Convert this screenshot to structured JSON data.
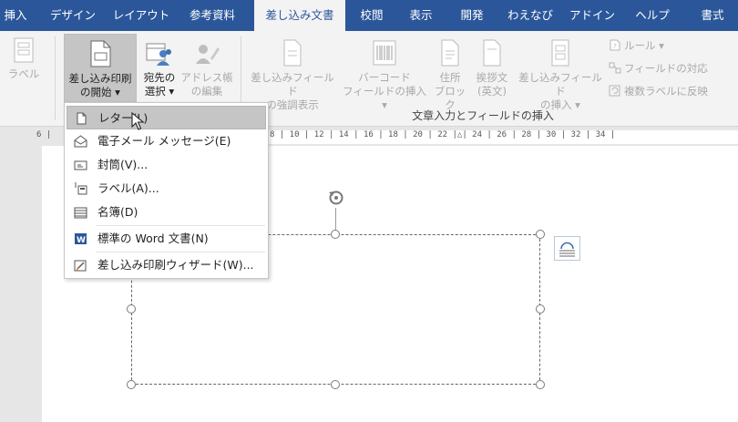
{
  "tabs": [
    "挿入",
    "デザイン",
    "レイアウト",
    "参考資料",
    "差し込み文書",
    "校閲",
    "表示",
    "開発",
    "わえなび",
    "アドイン",
    "ヘルプ",
    "書式"
  ],
  "active_tab": "差し込み文書",
  "ribbon": {
    "label_btn": "ラベル",
    "start_merge": [
      "差し込み印刷",
      "の開始 ▾"
    ],
    "select_recipients": [
      "宛先の",
      "選択 ▾"
    ],
    "edit_list": [
      "アドレス帳",
      "の編集"
    ],
    "highlight_fields": [
      "差し込みフィールド",
      "の強調表示"
    ],
    "barcode": [
      "バーコード",
      "フィールドの挿入 ▾"
    ],
    "address_block": [
      "住所",
      "ブロック"
    ],
    "greeting": [
      "挨拶文",
      "(英文)"
    ],
    "insert_field": [
      "差し込みフィールド",
      "の挿入 ▾"
    ],
    "rules": "ルール ▾",
    "match_fields": "フィールドの対応",
    "update_labels": "複数ラベルに反映",
    "group_label": "文章入力とフィールドの挿入"
  },
  "ruler": {
    "left": "6 |",
    "marks": "8 | 10 | 12 | 14 | 16 | 18 | 20 | 22 |△| 24 | 26 | 28 | 30 | 32 | 34 |"
  },
  "menu": {
    "items": [
      {
        "label": "レター(L)",
        "icon": "letter-doc-icon"
      },
      {
        "label": "電子メール メッセージ(E)",
        "icon": "envelope-open-icon"
      },
      {
        "label": "封筒(V)...",
        "icon": "envelope-icon"
      },
      {
        "label": "ラベル(A)...",
        "icon": "labels-icon"
      },
      {
        "label": "名簿(D)",
        "icon": "directory-icon"
      },
      {
        "label": "標準の Word 文書(N)",
        "icon": "word-icon"
      },
      {
        "label": "差し込み印刷ウィザード(W)...",
        "icon": "wizard-icon"
      }
    ]
  },
  "colors": {
    "accent": "#2b579a",
    "ribbon_bg": "#f3f3f3",
    "hover": "#c5c5c5"
  }
}
